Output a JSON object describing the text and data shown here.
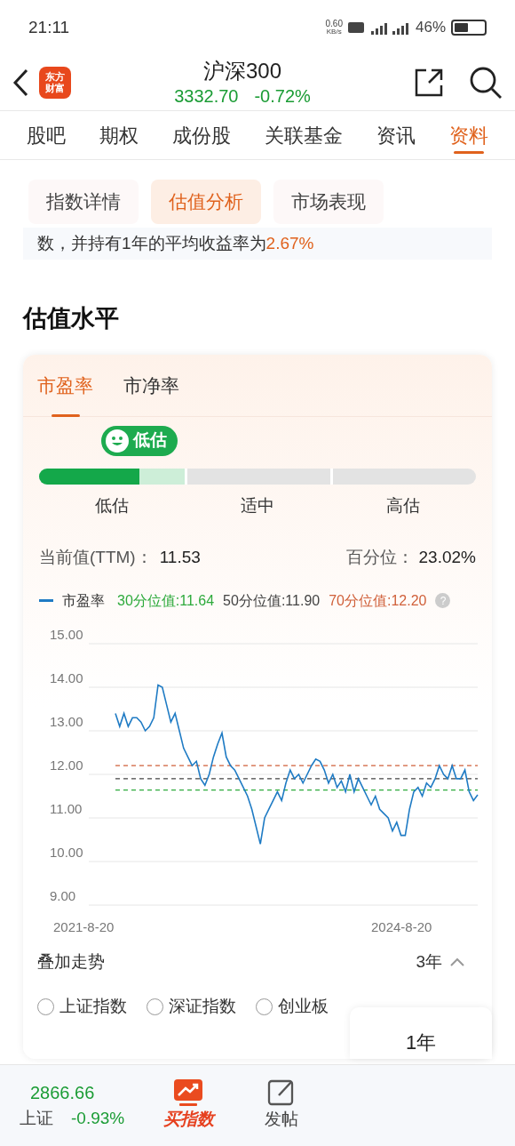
{
  "status_bar": {
    "time": "21:11",
    "speed": "0.60",
    "speed_unit": "KB/s",
    "battery": "46%"
  },
  "header": {
    "title": "沪深300",
    "price": "3332.70",
    "change": "-0.72%",
    "logo": "东方财富"
  },
  "tabs": [
    {
      "label": "股吧",
      "selected": false
    },
    {
      "label": "期权",
      "selected": false
    },
    {
      "label": "成份股",
      "selected": false
    },
    {
      "label": "关联基金",
      "selected": false
    },
    {
      "label": "资讯",
      "selected": false
    },
    {
      "label": "资料",
      "selected": true
    }
  ],
  "subtabs": [
    {
      "label": "指数详情",
      "selected": false
    },
    {
      "label": "估值分析",
      "selected": true
    },
    {
      "label": "市场表现",
      "selected": false
    }
  ],
  "cut_text": {
    "text": "数，并持有1年的平均收益率为",
    "highlight": "2.67%"
  },
  "section_title": "估值水平",
  "card": {
    "tabs": [
      {
        "label": "市盈率",
        "selected": true
      },
      {
        "label": "市净率",
        "selected": false
      }
    ],
    "badge": "低估",
    "level": 0.23,
    "zones": [
      "低估",
      "适中",
      "高估"
    ],
    "current": {
      "label": "当前值(TTM)：",
      "value": "11.53"
    },
    "percentile": {
      "label": "百分位：",
      "value": "23.02%"
    },
    "help": "?",
    "x_labels": [
      "2021-8-20",
      "2024-8-20"
    ],
    "chart_data": {
      "type": "line",
      "grid": true,
      "ylim": [
        9,
        15
      ],
      "yticks": [
        {
          "value": 9,
          "label": "9.00"
        },
        {
          "value": 10,
          "label": "10.00"
        },
        {
          "value": 11,
          "label": "11.00"
        },
        {
          "value": 12,
          "label": "12.00"
        },
        {
          "value": 13,
          "label": "13.00"
        },
        {
          "value": 14,
          "label": "14.00"
        },
        {
          "value": 15,
          "label": "15.00"
        }
      ],
      "series": [
        {
          "name": "市盈率",
          "color": "#1f7bc4",
          "values": [
            13.4,
            13.1,
            13.4,
            13.1,
            13.3,
            13.3,
            13.2,
            13.0,
            13.1,
            13.3,
            14.05,
            14.0,
            13.6,
            13.2,
            13.4,
            13.0,
            12.6,
            12.4,
            12.2,
            12.3,
            11.9,
            11.75,
            12.0,
            12.4,
            12.7,
            12.95,
            12.4,
            12.2,
            12.1,
            11.9,
            11.7,
            11.5,
            11.2,
            10.8,
            10.4,
            11.0,
            11.2,
            11.4,
            11.6,
            11.4,
            11.8,
            12.1,
            11.9,
            12.0,
            11.8,
            12.0,
            12.2,
            12.35,
            12.3,
            12.1,
            11.8,
            12.0,
            11.7,
            11.85,
            11.6,
            12.0,
            11.6,
            11.9,
            11.7,
            11.5,
            11.3,
            11.5,
            11.2,
            11.1,
            11.0,
            10.7,
            10.9,
            10.6,
            10.6,
            11.2,
            11.6,
            11.7,
            11.5,
            11.8,
            11.7,
            11.9,
            12.2,
            12.0,
            11.9,
            12.2,
            11.9,
            11.9,
            12.1,
            11.6,
            11.4,
            11.53
          ]
        }
      ],
      "ref_lines": [
        {
          "axis": "y",
          "value": 11.64,
          "label": "30分位值:11.64",
          "color": "#2eaa3c"
        },
        {
          "axis": "y",
          "value": 11.9,
          "label": "50分位值:11.90",
          "color": "#444444"
        },
        {
          "axis": "y",
          "value": 12.2,
          "label": "70分位值:12.20",
          "color": "#d0603a"
        }
      ]
    },
    "overlay": {
      "label": "叠加走势",
      "period": "3年",
      "options": [
        {
          "label": "上证指数",
          "selected": false
        },
        {
          "label": "深证指数",
          "selected": false
        },
        {
          "label": "创业板",
          "selected": false
        }
      ]
    },
    "popup": {
      "option": "1年"
    }
  },
  "bottom_bar": {
    "index_price": "2866.66",
    "index_name": "上证",
    "index_change": "-0.93%",
    "buy": "买指数",
    "post": "发帖"
  }
}
